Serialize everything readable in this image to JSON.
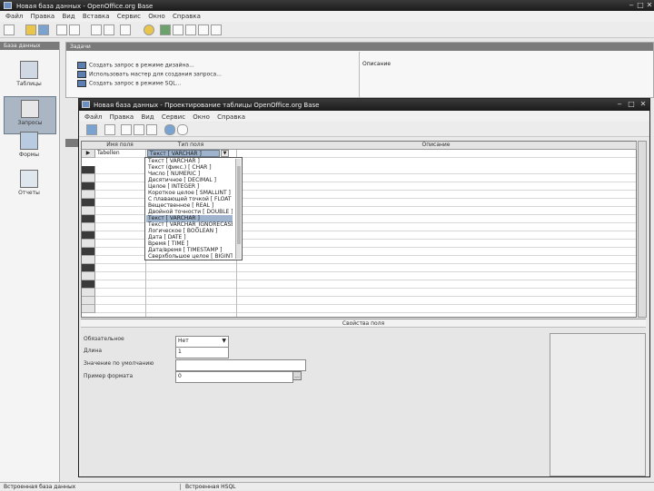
{
  "main_window": {
    "title": "Новая база данных - OpenOffice.org Base",
    "menu": [
      "Файл",
      "Правка",
      "Вид",
      "Вставка",
      "Сервис",
      "Окно",
      "Справка"
    ]
  },
  "sidebar": {
    "header": "База данных",
    "items": [
      {
        "label": "Таблицы",
        "selected": false
      },
      {
        "label": "Запросы",
        "selected": true
      },
      {
        "label": "Формы",
        "selected": false
      },
      {
        "label": "Отчеты",
        "selected": false
      }
    ]
  },
  "tasks": {
    "header": "Задачи",
    "items": [
      "Создать запрос в режиме дизайна...",
      "Использовать мастер для создания запроса...",
      "Создать запрос в режиме SQL..."
    ],
    "description_label": "Описание"
  },
  "table_window": {
    "title": "Новая база данных - Проектирование таблицы OpenOffice.org Base",
    "menu": [
      "Файл",
      "Правка",
      "Вид",
      "Сервис",
      "Окно",
      "Справка"
    ],
    "columns": [
      "Имя поля",
      "Тип поля",
      "Описание"
    ],
    "first_row": {
      "name": "Tabellen"
    },
    "type_combo_value": "Текст [ VARCHAR ]",
    "type_options": [
      "Текст [ VARCHAR ]",
      "Текст (фикс.) [ CHAR ]",
      "Число [ NUMERIC ]",
      "Десятичное [ DECIMAL ]",
      "Целое [ INTEGER ]",
      "Короткое целое [ SMALLINT ]",
      "С плавающей точкой [ FLOAT ]",
      "Вещественное [ REAL ]",
      "Двойной точности [ DOUBLE ]",
      "Текст [ VARCHAR ]",
      "Текст [ VARCHAR_IGNORECASE ]",
      "Логическое [ BOOLEAN ]",
      "Дата [ DATE ]",
      "Время [ TIME ]",
      "Дата/время [ TIMESTAMP ]",
      "Сверхбольшое целое [ BIGINT ]"
    ],
    "selected_option_index": 9,
    "properties_header": "Свойства поля",
    "props": {
      "required_label": "Обязательное",
      "required_value": "Нет",
      "length_label": "Длина",
      "length_value": "1",
      "default_label": "Значение по умолчанию",
      "default_value": "",
      "format_label": "Пример формата",
      "format_value": "0"
    }
  },
  "status_bar": {
    "left": "Встроенная база данных",
    "right": "Встроенная HSQL"
  }
}
